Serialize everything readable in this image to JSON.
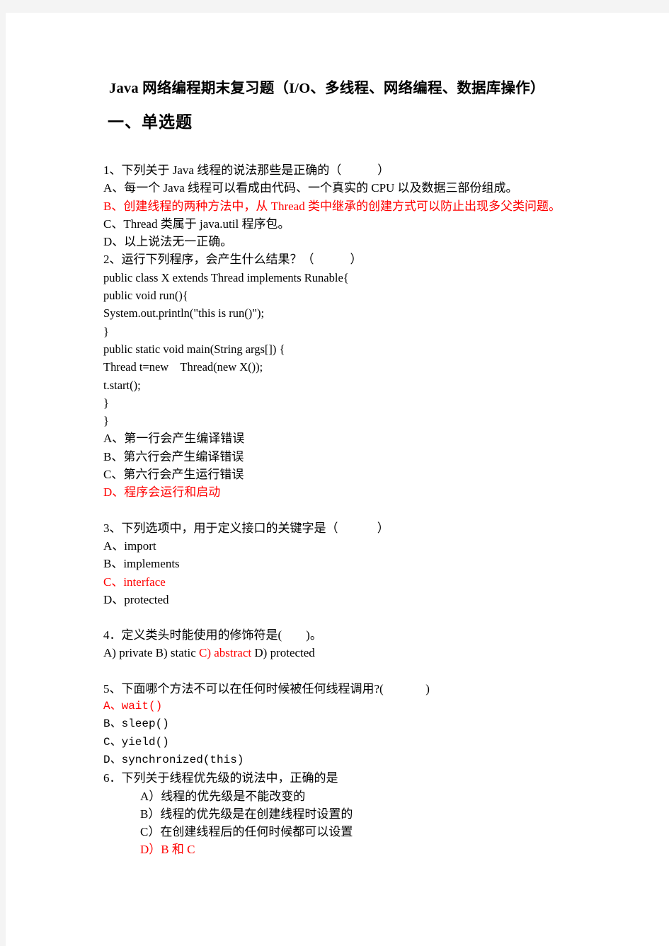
{
  "document": {
    "title": "Java 网络编程期末复习题（I/O、多线程、网络编程、数据库操作）",
    "section_heading": "一、单选题",
    "accent_red": "#ff0000",
    "page_background": "#ffffff",
    "outer_background": "#f4f4f4"
  },
  "questions": [
    {
      "id": "q1",
      "stem": "1、下列关于 Java 线程的说法那些是正确的（            ）",
      "options": [
        {
          "text": "A、每一个 Java 线程可以看成由代码、一个真实的 CPU 以及数据三部份组成。",
          "red": false
        },
        {
          "text": "B、创建线程的两种方法中，从 Thread 类中继承的创建方式可以防止出现多父类问题。",
          "red": true
        },
        {
          "text": "C、Thread 类属于 java.util 程序包。",
          "red": false
        },
        {
          "text": "D、以上说法无一正确。",
          "red": false
        }
      ]
    },
    {
      "id": "q2",
      "stem": "2、运行下列程序，会产生什么结果？（            ）",
      "code": [
        "public class X extends Thread implements Runable{",
        "public void run(){",
        "System.out.println(\"this is run()\");",
        "}",
        "public static void main(String args[]) {",
        "Thread t=new    Thread(new X());",
        "t.start();",
        "}",
        "}"
      ],
      "options": [
        {
          "text": "A、第一行会产生编译错误",
          "red": false
        },
        {
          "text": "B、第六行会产生编译错误",
          "red": false
        },
        {
          "text": "C、第六行会产生运行错误",
          "red": false
        },
        {
          "text": "D、程序会运行和启动",
          "red": true
        }
      ]
    },
    {
      "id": "q3",
      "stem": "3、下列选项中，用于定义接口的关键字是（             ）",
      "options": [
        {
          "text": "A、import",
          "red": false
        },
        {
          "text": "B、implements",
          "red": false
        },
        {
          "text": "C、interface",
          "red": true
        },
        {
          "text": "D、protected",
          "red": false
        }
      ]
    },
    {
      "id": "q4",
      "stem": "4．定义类头时能使用的修饰符是(        )。",
      "inline_options": {
        "prefix": "A) private B) static ",
        "red_part": "C) abstract",
        "suffix": " D) protected"
      }
    },
    {
      "id": "q5",
      "stem": "5、下面哪个方法不可以在任何时候被任何线程调用?(              )",
      "mono": true,
      "options": [
        {
          "text": "A、wait()",
          "red": true
        },
        {
          "text": "B、sleep()",
          "red": false
        },
        {
          "text": "C、yield()",
          "red": false
        },
        {
          "text": "D、synchronized(this)",
          "red": false
        }
      ]
    },
    {
      "id": "q6",
      "stem": "6．下列关于线程优先级的说法中，正确的是",
      "indented": true,
      "options": [
        {
          "text": "A）线程的优先级是不能改变的",
          "red": false
        },
        {
          "text": "B）线程的优先级是在创建线程时设置的",
          "red": false
        },
        {
          "text": "C）在创建线程后的任何时候都可以设置",
          "red": false
        },
        {
          "text": "D）B 和 C",
          "red": true
        }
      ]
    }
  ]
}
